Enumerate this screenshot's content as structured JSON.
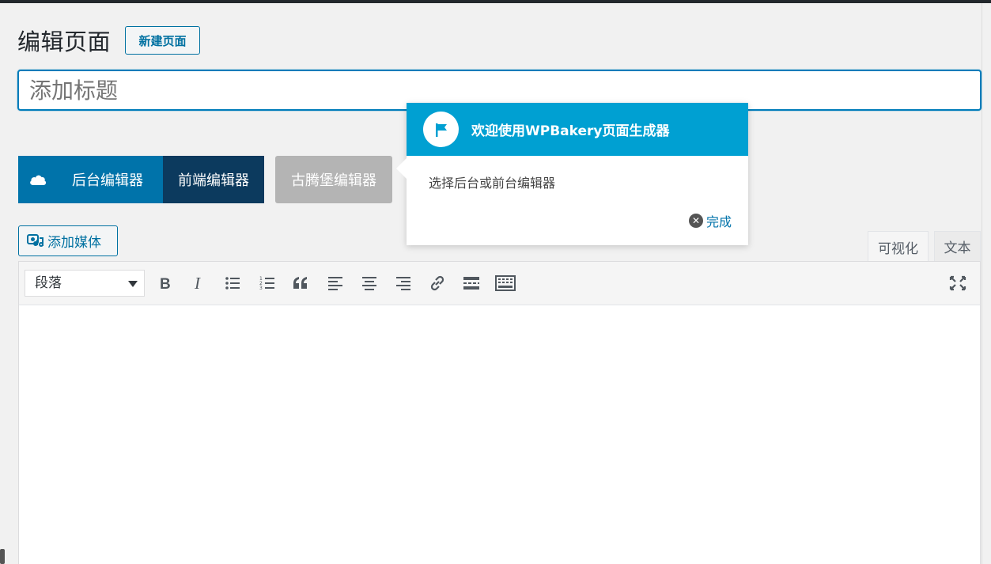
{
  "header": {
    "page_title": "编辑页面",
    "new_page_button": "新建页面"
  },
  "title_field": {
    "placeholder": "添加标题",
    "value": ""
  },
  "editor_switch": {
    "backend": "后台编辑器",
    "frontend": "前端编辑器",
    "gutenberg": "古腾堡编辑器"
  },
  "media": {
    "add_media": "添加媒体"
  },
  "editor_tabs": {
    "visual": "可视化",
    "text": "文本"
  },
  "toolbar": {
    "format_select": "段落",
    "buttons": [
      "bold",
      "italic",
      "bulleted-list",
      "numbered-list",
      "blockquote",
      "align-left",
      "align-center",
      "align-right",
      "insert-link",
      "read-more",
      "toolbar-toggle"
    ]
  },
  "pointer": {
    "title": "欢迎使用WPBakery页面生成器",
    "body": "选择后台或前台编辑器",
    "dismiss": "完成"
  },
  "colors": {
    "accent": "#0073aa",
    "frontend_dark": "#0c3a5e",
    "pointer_header": "#00a0d2",
    "disabled": "#b4b4b4"
  }
}
